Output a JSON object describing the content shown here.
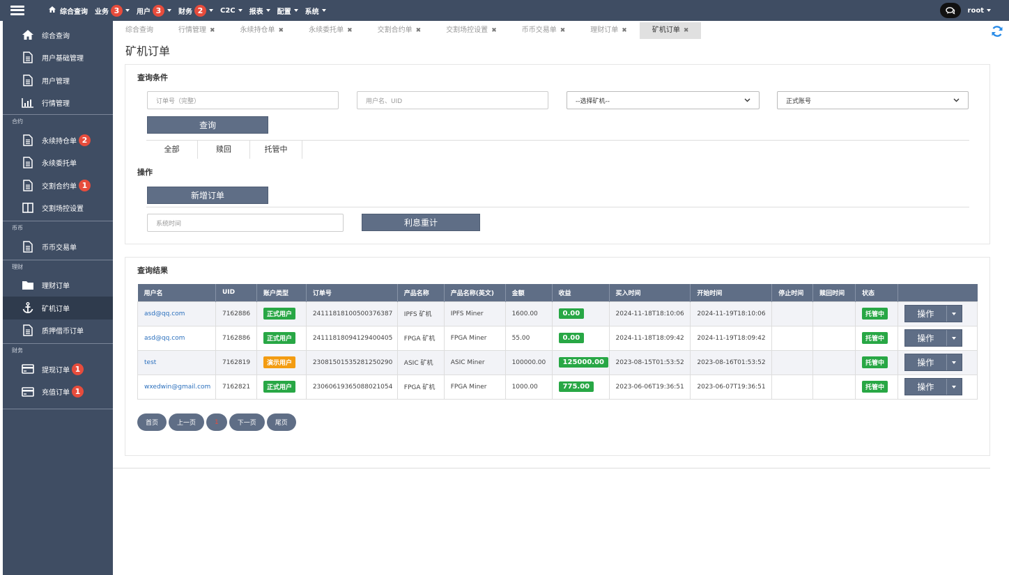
{
  "topnav": {
    "home": "综合查询",
    "items": [
      {
        "label": "业务",
        "badge": "3"
      },
      {
        "label": "用户",
        "badge": "3"
      },
      {
        "label": "财务",
        "badge": "2"
      },
      {
        "label": "C2C",
        "badge": ""
      },
      {
        "label": "报表",
        "badge": ""
      },
      {
        "label": "配置",
        "badge": ""
      },
      {
        "label": "系统",
        "badge": ""
      }
    ],
    "user": "root"
  },
  "sidebar": {
    "main_items": [
      "综合查询",
      "用户基础管理",
      "用户管理",
      "行情管理"
    ],
    "groups": [
      {
        "label": "合约",
        "items": [
          {
            "label": "永续持仓单",
            "badge": "2"
          },
          {
            "label": "永续委托单",
            "badge": ""
          },
          {
            "label": "交割合约单",
            "badge": "1"
          },
          {
            "label": "交割场控设置",
            "badge": ""
          }
        ]
      },
      {
        "label": "币币",
        "items": [
          {
            "label": "币币交易单",
            "badge": ""
          }
        ]
      },
      {
        "label": "理财",
        "items": [
          {
            "label": "理财订单",
            "badge": ""
          },
          {
            "label": "矿机订单",
            "badge": ""
          },
          {
            "label": "质押借币订单",
            "badge": ""
          }
        ]
      },
      {
        "label": "财务",
        "items": [
          {
            "label": "提现订单",
            "badge": "1"
          },
          {
            "label": "充值订单",
            "badge": "1"
          }
        ]
      }
    ]
  },
  "tabs": [
    "综合查询",
    "行情管理",
    "永续持仓单",
    "永续委托单",
    "交割合约单",
    "交割场控设置",
    "币币交易单",
    "理财订单",
    "矿机订单"
  ],
  "page_title": "矿机订单",
  "query": {
    "title": "查询条件",
    "order_placeholder": "订单号（完整）",
    "user_placeholder": "用户名、UID",
    "miner_select": "--选择矿机--",
    "account_select": "正式账号",
    "query_button": "查询",
    "subtabs": [
      "全部",
      "赎回",
      "托管中"
    ]
  },
  "ops": {
    "title": "操作",
    "add_button": "新增订单",
    "time_placeholder": "系统时间",
    "recalc_button": "利息重计"
  },
  "results": {
    "title": "查询结果",
    "columns": [
      "用户名",
      "UID",
      "账户类型",
      "订单号",
      "产品名称",
      "产品名称(英文)",
      "金额",
      "收益",
      "买入时间",
      "开始时间",
      "停止时间",
      "赎回时间",
      "状态",
      ""
    ],
    "op_label": "操作",
    "rows": [
      {
        "user": "asd@qq.com",
        "uid": "7162886",
        "type": "正式用户",
        "order": "24111818100500376387",
        "name": "IPFS 矿机",
        "name_en": "IPFS Miner",
        "amount": "1600.00",
        "profit": "0.00",
        "buy": "2024-11-18T18:10:06",
        "start": "2024-11-19T18:10:06",
        "stop": "",
        "redeem": "",
        "status": "托管中"
      },
      {
        "user": "asd@qq.com",
        "uid": "7162886",
        "type": "正式用户",
        "order": "24111818094129400405",
        "name": "FPGA 矿机",
        "name_en": "FPGA Miner",
        "amount": "55.00",
        "profit": "0.00",
        "buy": "2024-11-18T18:09:42",
        "start": "2024-11-19T18:09:42",
        "stop": "",
        "redeem": "",
        "status": "托管中"
      },
      {
        "user": "test",
        "uid": "7162819",
        "type": "演示用户",
        "order": "23081501535281250290",
        "name": "ASIC 矿机",
        "name_en": "ASIC Miner",
        "amount": "100000.00",
        "profit": "125000.00",
        "buy": "2023-08-15T01:53:52",
        "start": "2023-08-16T01:53:52",
        "stop": "",
        "redeem": "",
        "status": "托管中"
      },
      {
        "user": "wxedwin@gmail.com",
        "uid": "7162821",
        "type": "正式用户",
        "order": "23060619365088021054",
        "name": "FPGA 矿机",
        "name_en": "FPGA Miner",
        "amount": "1000.00",
        "profit": "775.00",
        "buy": "2023-06-06T19:36:51",
        "start": "2023-06-07T19:36:51",
        "stop": "",
        "redeem": "",
        "status": "托管中"
      }
    ]
  },
  "pager": [
    "首页",
    "上一页",
    "1",
    "下一页",
    "尾页"
  ],
  "colors": {
    "nav": "#3f4d63",
    "button": "#5f6e86",
    "badge": "#e74c3c",
    "green": "#28a745",
    "orange": "#f39c12",
    "link": "#2a6fbd"
  }
}
